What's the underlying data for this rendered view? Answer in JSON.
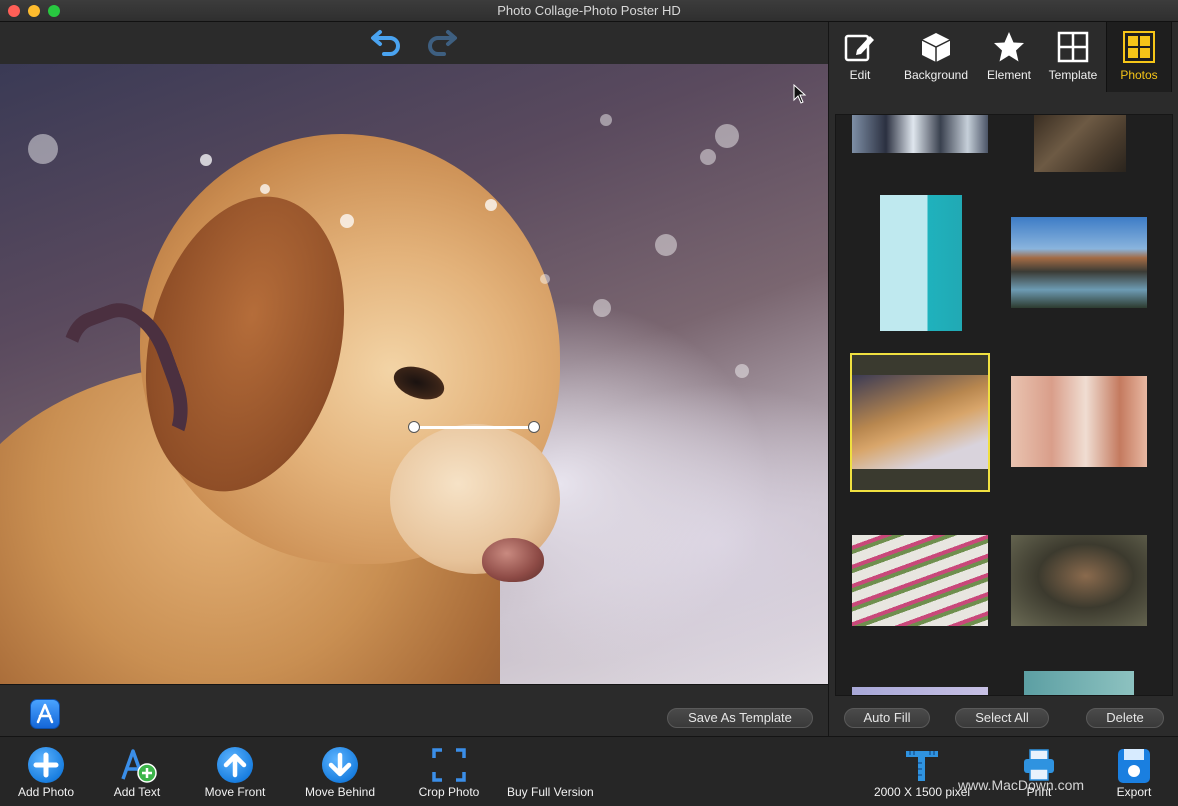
{
  "window": {
    "title": "Photo Collage-Photo Poster HD"
  },
  "right_tabs": [
    {
      "label": "Edit",
      "icon": "edit-icon"
    },
    {
      "label": "Background",
      "icon": "cube-icon"
    },
    {
      "label": "Element",
      "icon": "star-icon"
    },
    {
      "label": "Template",
      "icon": "template-grid-icon"
    },
    {
      "label": "Photos",
      "icon": "photos-grid-icon",
      "active": true
    }
  ],
  "photo_actions": {
    "auto_fill": "Auto Fill",
    "select_all": "Select All",
    "delete": "Delete"
  },
  "canvas_actions": {
    "save_as_template": "Save As Template"
  },
  "bottom_toolbar": {
    "add_photo": "Add Photo",
    "add_text": "Add Text",
    "move_front": "Move Front",
    "move_behind": "Move Behind",
    "crop_photo": "Crop Photo",
    "buy_full_version": "Buy Full Version",
    "canvas_size": "2000 X 1500 pixel",
    "print": "Print",
    "export": "Export"
  },
  "watermark": "www.MacDown.com",
  "colors": {
    "accent_yellow": "#f5c518",
    "icon_blue": "#1a7fe0",
    "selected_outline": "#f0e040"
  }
}
